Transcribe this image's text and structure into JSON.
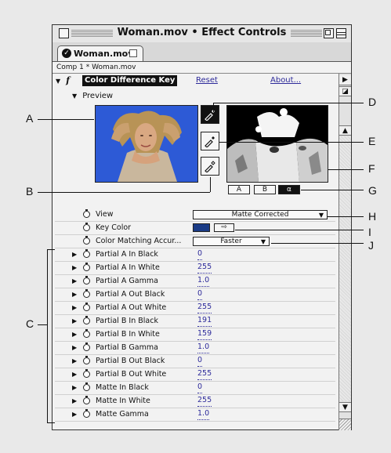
{
  "window": {
    "title": "Woman.mov • Effect Controls",
    "tab_label": "Woman.mov",
    "comp_line": "Comp 1 * Woman.mov"
  },
  "effect": {
    "name": "Color Difference Key",
    "reset_label": "Reset",
    "about_label": "About...",
    "preview_label": "Preview"
  },
  "view_buttons": [
    "A",
    "B",
    "α"
  ],
  "properties": {
    "view": {
      "label": "View",
      "value": "Matte Corrected"
    },
    "key_color": {
      "label": "Key Color",
      "color": "#1a3b86"
    },
    "matching": {
      "label": "Color Matching Accur...",
      "value": "Faster"
    },
    "params": [
      {
        "label": "Partial A In Black",
        "value": "0"
      },
      {
        "label": "Partial A In White",
        "value": "255"
      },
      {
        "label": "Partial A Gamma",
        "value": "1.0"
      },
      {
        "label": "Partial A Out Black",
        "value": "0"
      },
      {
        "label": "Partial A Out White",
        "value": "255"
      },
      {
        "label": "Partial B In Black",
        "value": "191"
      },
      {
        "label": "Partial B In White",
        "value": "159"
      },
      {
        "label": "Partial B Gamma",
        "value": "1.0"
      },
      {
        "label": "Partial B Out Black",
        "value": "0"
      },
      {
        "label": "Partial B Out White",
        "value": "255"
      },
      {
        "label": "Matte In Black",
        "value": "0"
      },
      {
        "label": "Matte In White",
        "value": "255"
      },
      {
        "label": "Matte Gamma",
        "value": "1.0"
      }
    ]
  },
  "callouts": {
    "A": "A",
    "B": "B",
    "C": "C",
    "D": "D",
    "E": "E",
    "F": "F",
    "G": "G",
    "H": "H",
    "I": "I",
    "J": "J"
  },
  "icons": {
    "eyedroppers": [
      "eyedropper-icon",
      "eyedropper-plus-icon",
      "eyedropper-minus-icon"
    ],
    "stopwatch": "stopwatch-icon"
  }
}
